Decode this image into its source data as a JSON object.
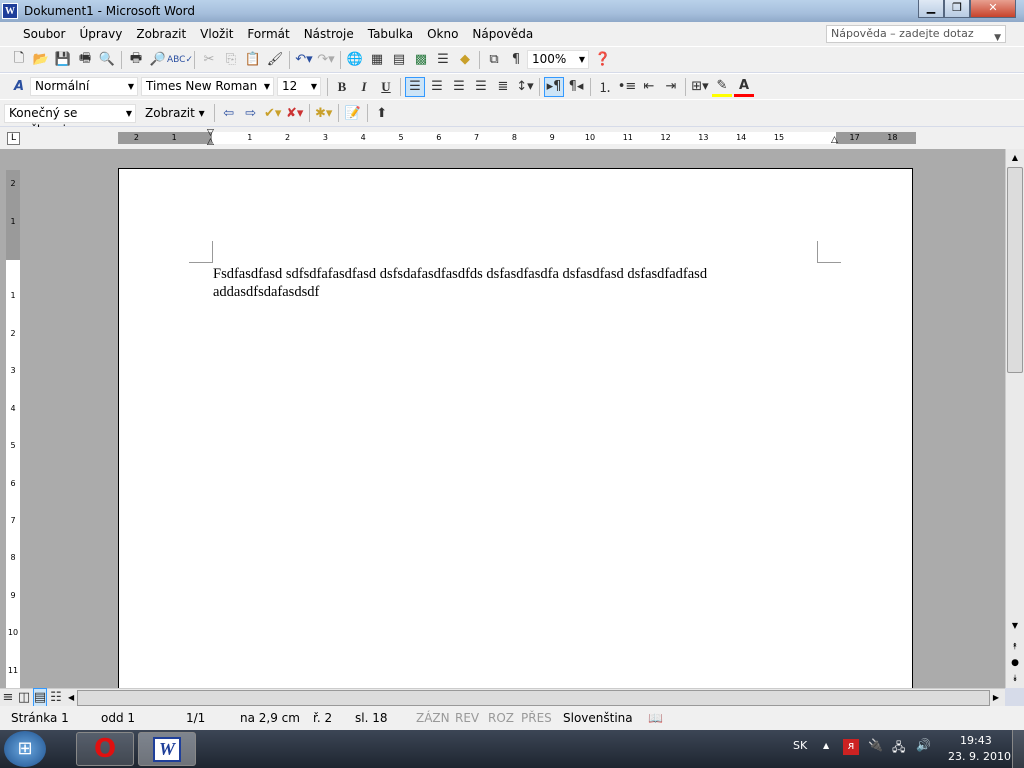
{
  "window": {
    "title": "Dokument1 - Microsoft Word",
    "app_icon": "W",
    "controls": [
      "minimize",
      "restore",
      "close"
    ]
  },
  "menu": {
    "items": [
      "Soubor",
      "Úpravy",
      "Zobrazit",
      "Vložit",
      "Formát",
      "Nástroje",
      "Tabulka",
      "Okno",
      "Nápověda"
    ],
    "help_placeholder": "Nápověda – zadejte dotaz"
  },
  "toolbar_standard": {
    "icons": [
      "new-document",
      "open",
      "save",
      "permission",
      "search-file",
      "print",
      "print-preview",
      "spelling",
      "cut",
      "copy",
      "paste",
      "format-painter",
      "undo",
      "redo",
      "hyperlink",
      "tables-borders",
      "insert-table",
      "insert-excel",
      "columns",
      "drawing",
      "document-map",
      "show-formatting"
    ],
    "zoom": "100%"
  },
  "toolbar_formatting": {
    "style": "Normální",
    "font": "Times New Roman",
    "size": "12",
    "bold": "B",
    "italic": "I",
    "underline": "U",
    "alignment_active": "left",
    "highlight_color": "#ffff00",
    "font_color": "#ff0000"
  },
  "toolbar_reviewing": {
    "display_mode": "Konečný se značkami",
    "show_label": "Zobrazit"
  },
  "ruler": {
    "horizontal_left": [
      "2",
      "1"
    ],
    "horizontal": [
      "1",
      "2",
      "3",
      "4",
      "5",
      "6",
      "7",
      "8",
      "9",
      "10",
      "11",
      "12",
      "13",
      "14",
      "15"
    ],
    "horizontal_right": [
      "17",
      "18"
    ],
    "vertical_top": [
      "2",
      "1"
    ],
    "vertical": [
      "1",
      "2",
      "3",
      "4",
      "5",
      "6",
      "7",
      "8",
      "9",
      "10",
      "11"
    ]
  },
  "document": {
    "lines": [
      "Fsdfasdfasd  sdfsdfafasdfasd dsfsdafasdfasdfds dsfasdfasdfa dsfasdfasd dsfasdfadfasd",
      "addasdfsdafasdsdf"
    ]
  },
  "status": {
    "page": "Stránka 1",
    "section": "odd 1",
    "pages": "1/1",
    "at": "na 2,9 cm",
    "line": "ř. 2",
    "col": "sl. 18",
    "rec": "ZÁZN",
    "trk": "REV",
    "ext": "ROZ",
    "ovr": "PŘES",
    "language": "Slovenština"
  },
  "taskbar": {
    "lang": "SK",
    "time": "19:43",
    "date": "23. 9. 2010"
  }
}
